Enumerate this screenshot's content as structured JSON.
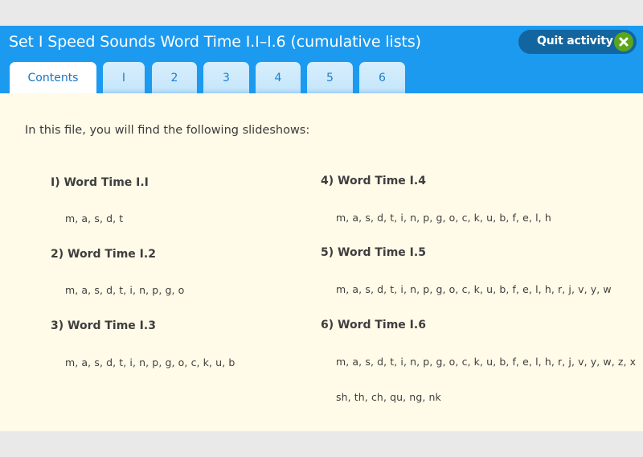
{
  "header": {
    "title": "Set I Speed Sounds Word Time I.I–I.6 (cumulative lists)",
    "quit_button": {
      "label": "Quit activity",
      "icon": "close-icon"
    }
  },
  "tabs": [
    {
      "label": "Contents",
      "active": true
    },
    {
      "label": "I",
      "active": false
    },
    {
      "label": "2",
      "active": false
    },
    {
      "label": "3",
      "active": false
    },
    {
      "label": "4",
      "active": false
    },
    {
      "label": "5",
      "active": false
    },
    {
      "label": "6",
      "active": false
    }
  ],
  "colors": {
    "header_blue": "#1b9af0",
    "quit_button_bg": "#13659f",
    "quit_icon_green": "#5ca61e",
    "content_bg": "#fffbe8",
    "tab_inactive_bg": "#d6eefd",
    "tab_text": "#1a7fd0"
  },
  "content": {
    "intro": "In this file, you will find the following slideshows:",
    "entries": [
      {
        "title": "I) Word Time I.I",
        "sounds": [
          "m, a, s, d, t"
        ]
      },
      {
        "title": "2) Word Time I.2",
        "sounds": [
          "m, a, s, d, t, i, n, p, g, o"
        ]
      },
      {
        "title": "3) Word Time I.3",
        "sounds": [
          "m, a, s, d, t, i, n, p, g, o, c, k, u, b"
        ]
      },
      {
        "title": "4) Word Time I.4",
        "sounds": [
          "m, a, s, d, t, i, n, p, g, o, c, k, u, b, f, e, l, h"
        ]
      },
      {
        "title": "5) Word Time I.5",
        "sounds": [
          "m, a, s, d, t, i, n, p, g, o, c, k, u, b, f, e, l, h, r, j, v, y, w"
        ]
      },
      {
        "title": "6) Word Time I.6",
        "sounds": [
          "m, a, s, d, t, i, n, p, g, o, c, k, u, b, f, e, l, h, r, j, v, y, w, z, x",
          "sh, th, ch, qu, ng, nk"
        ]
      }
    ]
  }
}
